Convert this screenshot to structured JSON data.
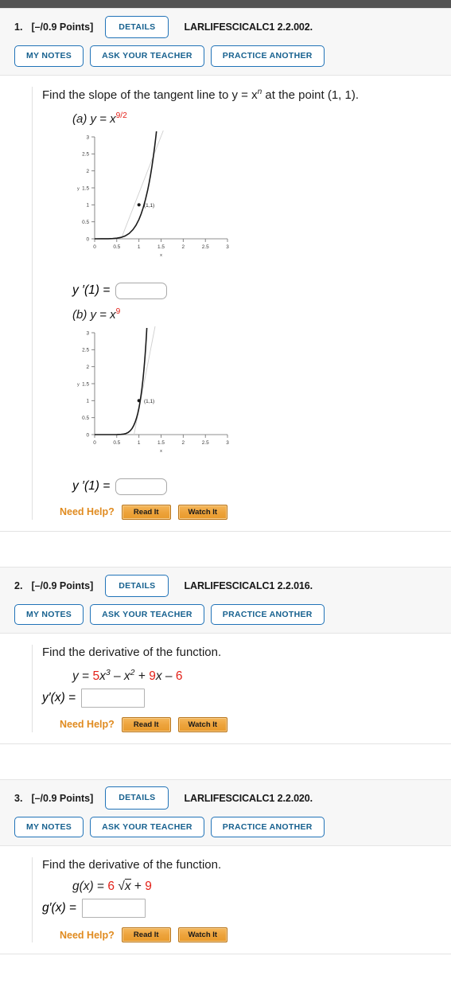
{
  "problems": [
    {
      "number": "1.",
      "points": "[–/0.9 Points]",
      "details_label": "DETAILS",
      "code": "LARLIFESCICALC1 2.2.002.",
      "my_notes": "MY NOTES",
      "ask_teacher": "ASK YOUR TEACHER",
      "practice": "PRACTICE ANOTHER",
      "question": "Find the slope of the tangent line to y = x",
      "question_exp": "n",
      "question_tail": " at the point (1, 1).",
      "part_a": {
        "label": "(a) y = x",
        "exp": "9/2"
      },
      "part_b": {
        "label": "(b) y = x",
        "exp": "9"
      },
      "answer_label": "y ′(1) =",
      "answer_value": "",
      "need_help": "Need Help?",
      "read_it": "Read It",
      "watch_it": "Watch It"
    },
    {
      "number": "2.",
      "points": "[–/0.9 Points]",
      "details_label": "DETAILS",
      "code": "LARLIFESCICALC1 2.2.016.",
      "my_notes": "MY NOTES",
      "ask_teacher": "ASK YOUR TEACHER",
      "practice": "PRACTICE ANOTHER",
      "question": "Find the derivative of the function.",
      "answer_label": "y′(x) =",
      "answer_value": "",
      "need_help": "Need Help?",
      "read_it": "Read It",
      "watch_it": "Watch It"
    },
    {
      "number": "3.",
      "points": "[–/0.9 Points]",
      "details_label": "DETAILS",
      "code": "LARLIFESCICALC1 2.2.020.",
      "my_notes": "MY NOTES",
      "ask_teacher": "ASK YOUR TEACHER",
      "practice": "PRACTICE ANOTHER",
      "question": "Find the derivative of the function.",
      "answer_label": "g′(x) =",
      "answer_value": "",
      "need_help": "Need Help?",
      "read_it": "Read It",
      "watch_it": "Watch It"
    }
  ],
  "equations": {
    "p2": {
      "lhs": "y",
      "eq": "=",
      "t1_coef": "5",
      "t1_var": "x",
      "t1_exp": "3",
      "op1": "–",
      "t2_var": "x",
      "t2_exp": "2",
      "op2": "+",
      "t3_coef": "9",
      "t3_var": "x",
      "op3": "–",
      "t4": "6"
    },
    "p3": {
      "lhs": "g(x)",
      "eq": "=",
      "t1_coef": "6",
      "radical": "√",
      "radicand": "x",
      "op1": "+",
      "t2": "9"
    }
  },
  "colors": {
    "accent_blue": "#2173b8",
    "red": "#e32119",
    "orange": "#e08b20",
    "topbar": "#545454"
  },
  "chart_data": [
    {
      "type": "line",
      "title": "(a) y = x^(9/2)",
      "xlabel": "x",
      "ylabel": "y",
      "xlim": [
        0,
        3
      ],
      "ylim": [
        0,
        3
      ],
      "xticks": [
        "0",
        "0.5",
        "1",
        "1.5",
        "2",
        "2.5",
        "3"
      ],
      "yticks": [
        "0",
        "0.5",
        "1",
        "1.5",
        "2",
        "2.5",
        "3"
      ],
      "grid": false,
      "series": [
        {
          "name": "y = x^(9/2)",
          "color": "#1a1a1a",
          "exponent": 4.5
        },
        {
          "name": "tangent at (1,1)",
          "color": "#bdbdbd",
          "slope": 4.5,
          "through": [
            1,
            1
          ]
        }
      ],
      "annotations": [
        {
          "text": "(1,1)",
          "x": 1,
          "y": 1
        }
      ]
    },
    {
      "type": "line",
      "title": "(b) y = x^9",
      "xlabel": "x",
      "ylabel": "y",
      "xlim": [
        0,
        3
      ],
      "ylim": [
        0,
        3
      ],
      "xticks": [
        "0",
        "0.5",
        "1",
        "1.5",
        "2",
        "2.5",
        "3"
      ],
      "yticks": [
        "0",
        "0.5",
        "1",
        "1.5",
        "2",
        "2.5",
        "3"
      ],
      "grid": false,
      "series": [
        {
          "name": "y = x^9",
          "color": "#1a1a1a",
          "exponent": 9
        },
        {
          "name": "tangent at (1,1)",
          "color": "#bdbdbd",
          "slope": 9,
          "through": [
            1,
            1
          ]
        }
      ],
      "annotations": [
        {
          "text": "(1,1)",
          "x": 1,
          "y": 1
        }
      ]
    }
  ]
}
